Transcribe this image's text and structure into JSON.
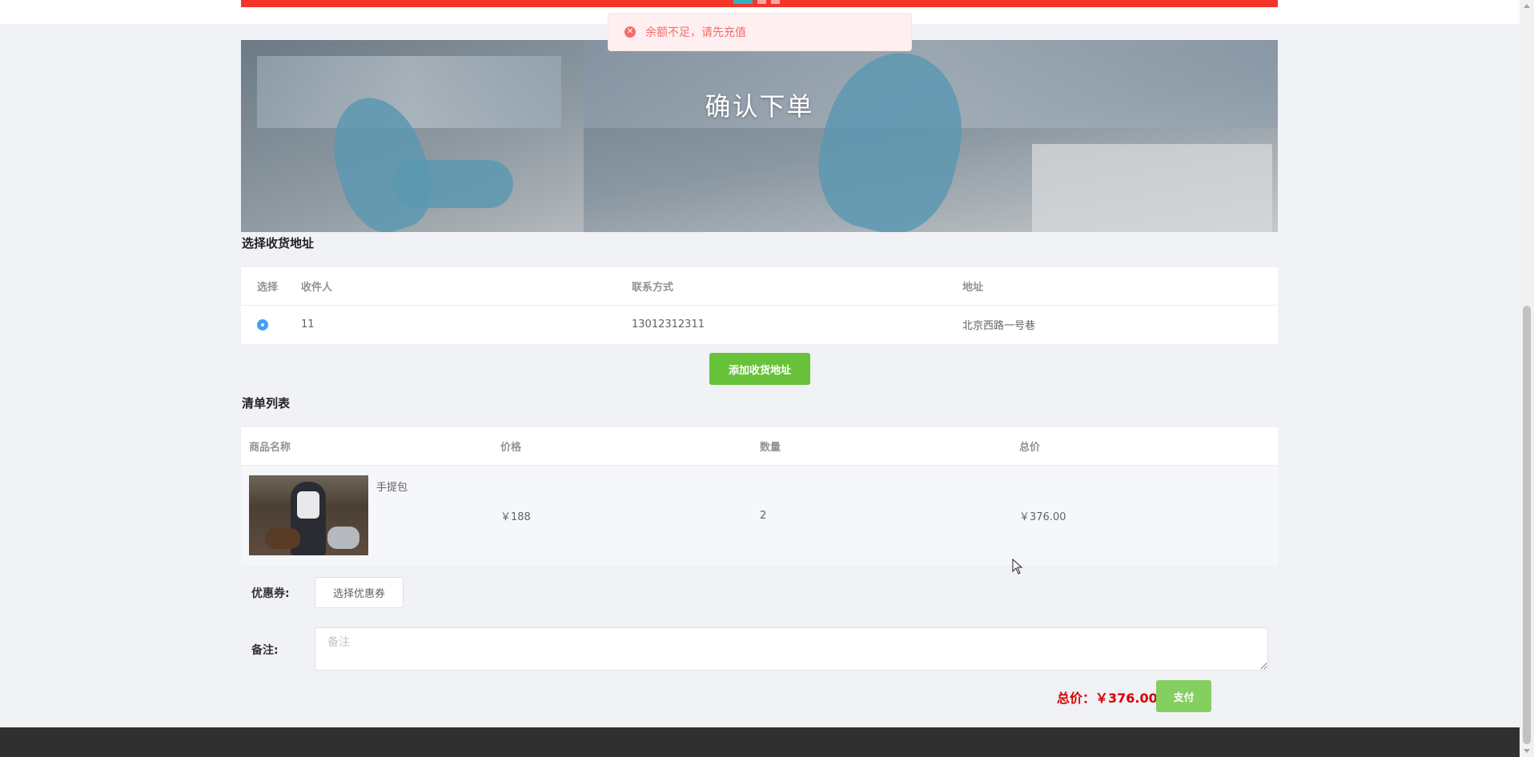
{
  "toast": {
    "message": "余额不足，请先充值"
  },
  "banner": {
    "title": "确认下单"
  },
  "address_section": {
    "title": "选择收货地址",
    "headers": [
      "选择",
      "收件人",
      "联系方式",
      "地址"
    ],
    "rows": [
      {
        "recipient": "11",
        "phone": "13012312311",
        "address": "北京西路一号巷",
        "selected": true
      }
    ],
    "add_button": "添加收货地址"
  },
  "list_section": {
    "title": "清单列表",
    "headers": [
      "商品名称",
      "价格",
      "数量",
      "总价"
    ],
    "items": [
      {
        "name": "手提包",
        "price": "￥188",
        "quantity": "2",
        "total": "￥376.00"
      }
    ]
  },
  "coupon": {
    "label": "优惠券:",
    "button": "选择优惠券"
  },
  "remark": {
    "label": "备注:",
    "placeholder": "备注"
  },
  "checkout": {
    "total": "总价：￥376.00",
    "pay_button": "支付"
  },
  "colors": {
    "accent_red": "#f5352a",
    "success_green": "#67c23a",
    "radio_blue": "#409eff",
    "price_red": "#d60000",
    "footer": "#303030"
  }
}
